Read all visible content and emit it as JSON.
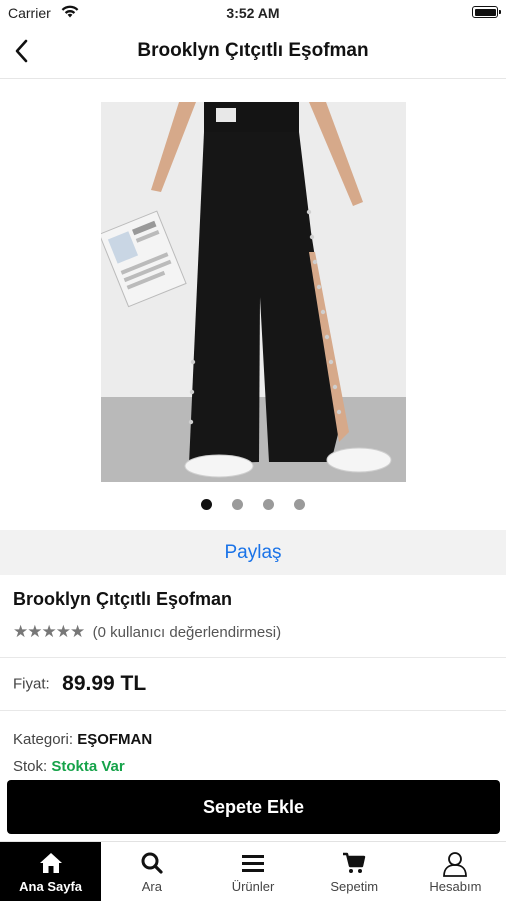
{
  "status_bar": {
    "carrier": "Carrier",
    "time": "3:52 AM"
  },
  "nav": {
    "title": "Brooklyn Çıtçıtlı Eşofman",
    "back_icon": "chevron-left-icon"
  },
  "gallery": {
    "image_count": 4,
    "active_index": 0
  },
  "share": {
    "label": "Paylaş"
  },
  "product": {
    "name": "Brooklyn Çıtçıtlı Eşofman",
    "stars": "★★★★★",
    "rating_text": "(0 kullanıcı değerlendirmesi)",
    "price_label": "Fiyat:",
    "price": "89.99 TL",
    "category_label": "Kategori:",
    "category": "EŞOFMAN",
    "stock_label": "Stok:",
    "stock": "Stokta Var"
  },
  "add_to_cart": {
    "label": "Sepete Ekle"
  },
  "tabs": [
    {
      "label": "Ana Sayfa",
      "icon": "home-icon",
      "active": true
    },
    {
      "label": "Ara",
      "icon": "search-icon",
      "active": false
    },
    {
      "label": "Ürünler",
      "icon": "menu-icon",
      "active": false
    },
    {
      "label": "Sepetim",
      "icon": "cart-icon",
      "active": false
    },
    {
      "label": "Hesabım",
      "icon": "user-icon",
      "active": false
    }
  ],
  "colors": {
    "accent_link": "#1a73e8",
    "stock_ok": "#16a34a",
    "primary_button": "#000000"
  }
}
